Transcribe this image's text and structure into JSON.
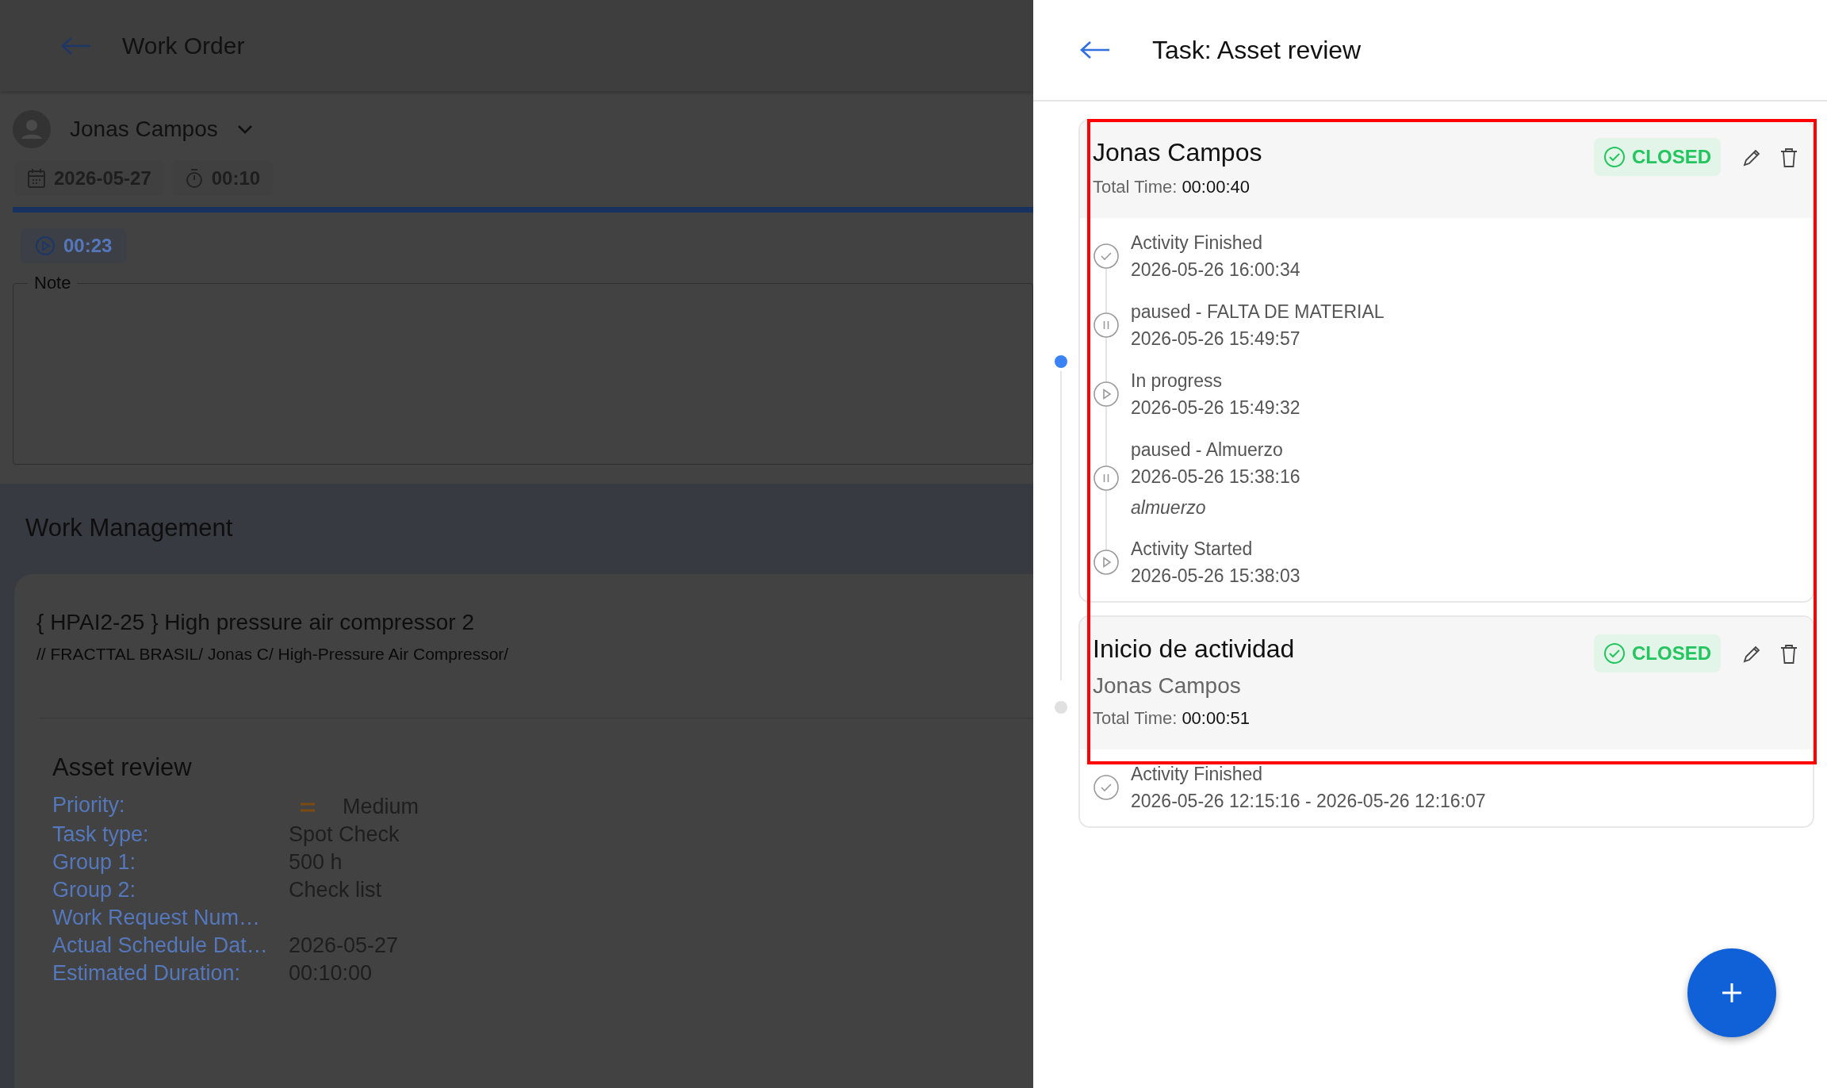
{
  "work_order": {
    "title": "Work Order",
    "assignee": "Jonas Campos",
    "date": "2026-05-27",
    "duration": "00:10",
    "timer": "00:23",
    "note": {
      "label": "Note"
    },
    "section_title": "Work Management",
    "asset": {
      "title": "{ HPAI2-25 } High pressure air compressor 2",
      "path": "// FRACTTAL BRASIL/ Jonas C/ High-Pressure Air Compressor/"
    },
    "task": {
      "title": "Asset review",
      "fields": [
        {
          "label": "Priority:",
          "value": "Medium",
          "kind": "priority"
        },
        {
          "label": "Task type:",
          "value": "Spot Check",
          "kind": "text"
        },
        {
          "label": "Group 1:",
          "value": "500 h",
          "kind": "text"
        },
        {
          "label": "Group 2:",
          "value": "Check list",
          "kind": "text"
        },
        {
          "label": "Work Request Num…"
        },
        {
          "label": "Actual Schedule Dat…",
          "value": "2026-05-27",
          "kind": "text"
        },
        {
          "label": "Estimated Duration:",
          "value": "00:10:00",
          "kind": "text"
        }
      ]
    }
  },
  "task_panel": {
    "title": "Task: Asset review",
    "activities": [
      {
        "title": "Jonas Campos",
        "total_label": "Total Time:",
        "total_time": "00:00:40",
        "status": "CLOSED",
        "selected": true,
        "events": [
          {
            "kind": "finished",
            "label": "Activity Finished",
            "time": "2026-05-26 16:00:34"
          },
          {
            "kind": "paused",
            "label": "paused - FALTA DE MATERIAL",
            "time": "2026-05-26 15:49:57"
          },
          {
            "kind": "progress",
            "label": "In progress",
            "time": "2026-05-26 15:49:32"
          },
          {
            "kind": "paused",
            "label": "paused - Almuerzo",
            "time": "2026-05-26 15:38:16",
            "note": "almuerzo"
          },
          {
            "kind": "progress",
            "label": "Activity Started",
            "time": "2026-05-26 15:38:03"
          }
        ]
      },
      {
        "title": "Inicio de actividad",
        "subtitle": "Jonas Campos",
        "total_label": "Total Time:",
        "total_time": "00:00:51",
        "status": "CLOSED",
        "selected": false,
        "events": [
          {
            "kind": "finished",
            "label": "Activity Finished",
            "time": "2026-05-26 12:15:16 - 2026-05-26 12:16:07"
          }
        ]
      }
    ]
  }
}
